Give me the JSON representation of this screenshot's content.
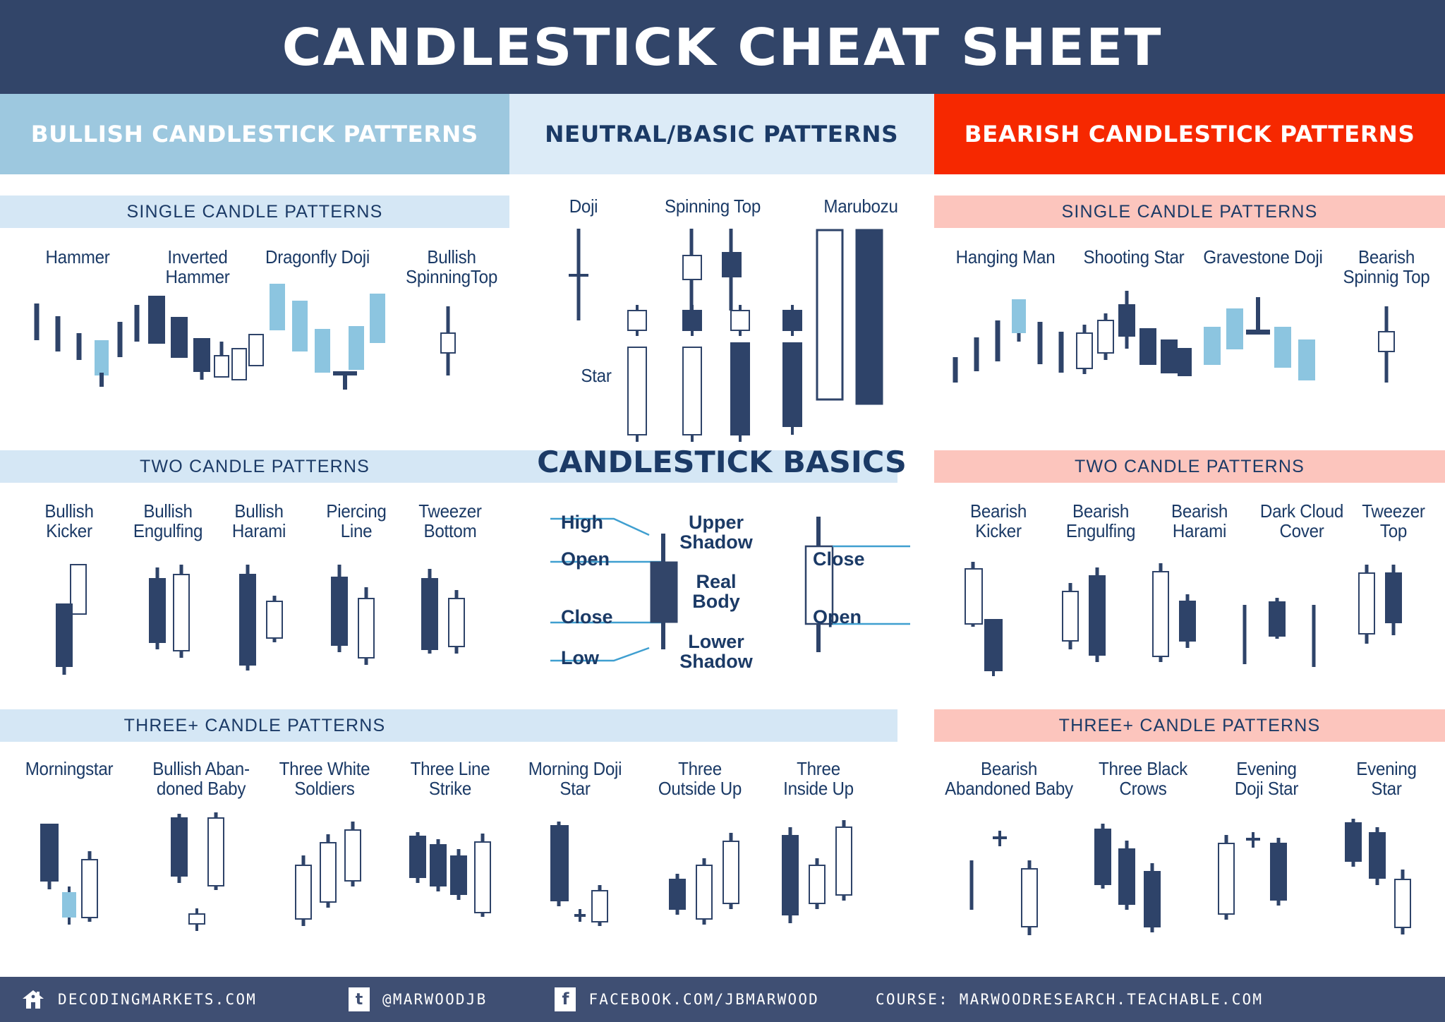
{
  "header": {
    "title": "CANDLESTICK CHEAT SHEET"
  },
  "columns": {
    "bullish": {
      "banner": "BULLISH CANDLESTICK PATTERNS"
    },
    "neutral": {
      "banner": "NEUTRAL/BASIC PATTERNS"
    },
    "bearish": {
      "banner": "BEARISH CANDLESTICK PATTERNS"
    }
  },
  "section_bars": {
    "bull_single": "SINGLE CANDLE PATTERNS",
    "bull_two": "TWO CANDLE PATTERNS",
    "bull_three": "THREE+ CANDLE PATTERNS",
    "bear_single": "SINGLE CANDLE PATTERNS",
    "bear_two": "TWO CANDLE PATTERNS",
    "bear_three": "THREE+ CANDLE PATTERNS"
  },
  "basics": {
    "title": "CANDLESTICK BASICS",
    "labels": {
      "high": "High",
      "open": "Open",
      "close": "Close",
      "low": "Low",
      "upper_shadow": "Upper\nShadow",
      "real_body": "Real\nBody",
      "lower_shadow": "Lower\nShadow",
      "close_right": "Close",
      "open_right": "Open"
    }
  },
  "patterns": {
    "bullish_single": [
      {
        "name": "Hammer"
      },
      {
        "name": "Inverted\nHammer"
      },
      {
        "name": "Dragonfly Doji"
      },
      {
        "name": "Bullish\nSpinningTop"
      }
    ],
    "bullish_two": [
      {
        "name": "Bullish\nKicker"
      },
      {
        "name": "Bullish\nEngulfing"
      },
      {
        "name": "Bullish\nHarami"
      },
      {
        "name": "Piercing\nLine"
      },
      {
        "name": "Tweezer\nBottom"
      }
    ],
    "bullish_three": [
      {
        "name": "Morningstar"
      },
      {
        "name": "Bullish Aban-\ndoned Baby"
      },
      {
        "name": "Three White\nSoldiers"
      },
      {
        "name": "Three Line\nStrike"
      },
      {
        "name": "Morning Doji\nStar"
      },
      {
        "name": "Three\nOutside Up"
      },
      {
        "name": "Three\nInside Up"
      }
    ],
    "neutral": [
      {
        "name": "Doji"
      },
      {
        "name": "Spinning Top"
      },
      {
        "name": "Marubozu"
      },
      {
        "name": "Star"
      }
    ],
    "bearish_single": [
      {
        "name": "Hanging Man"
      },
      {
        "name": "Shooting Star"
      },
      {
        "name": "Gravestone Doji"
      },
      {
        "name": "Bearish\nSpinnig Top"
      }
    ],
    "bearish_two": [
      {
        "name": "Bearish\nKicker"
      },
      {
        "name": "Bearish\nEngulfing"
      },
      {
        "name": "Bearish\nHarami"
      },
      {
        "name": "Dark Cloud\nCover"
      },
      {
        "name": "Tweezer\nTop"
      }
    ],
    "bearish_three": [
      {
        "name": "Bearish\nAbandoned Baby"
      },
      {
        "name": "Three Black\nCrows"
      },
      {
        "name": "Evening\nDoji Star"
      },
      {
        "name": "Evening\nStar"
      }
    ]
  },
  "footer": {
    "items": [
      {
        "icon": "home-icon",
        "text": "DECODINGMARKETS.COM"
      },
      {
        "icon": "twitter-icon",
        "text": "@MARWOODJB"
      },
      {
        "icon": "facebook-icon",
        "text": "FACEBOOK.COM/JBMARWOOD"
      },
      {
        "icon": "none",
        "text": "COURSE: MARWOODRESEARCH.TEACHABLE.COM"
      }
    ]
  },
  "colors": {
    "navy_dark": "#324569",
    "navy_text": "#1b3a66",
    "bull_banner": "#9dc8df",
    "neutral_banner": "#dcebf7",
    "bear_banner": "#f62800",
    "bull_subbar": "#d5e7f5",
    "bear_subbar": "#fcc5bd",
    "candle_dark": "#2e4369",
    "candle_light": "#8cc5e0",
    "footer": "#3f4f73"
  }
}
